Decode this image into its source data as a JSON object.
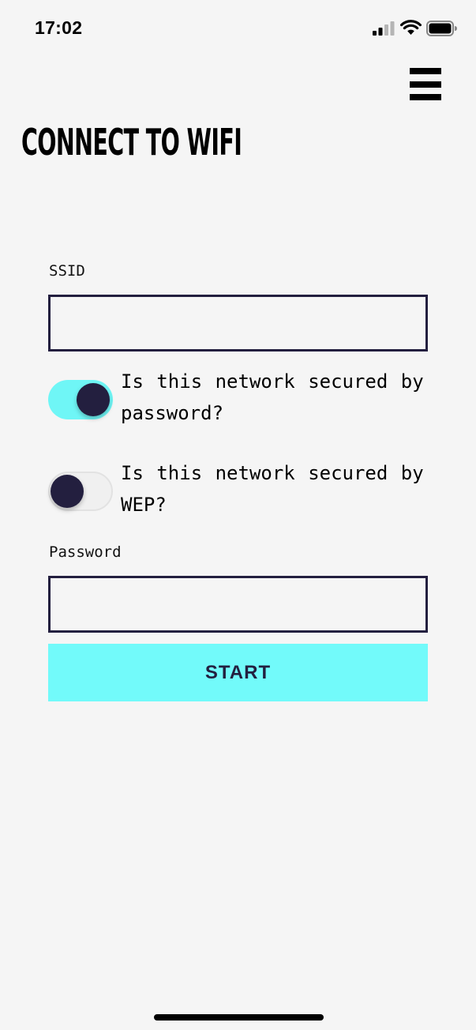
{
  "status_bar": {
    "time": "17:02",
    "icons": [
      "signal-icon",
      "wifi-icon",
      "battery-icon"
    ]
  },
  "header": {
    "menu_icon": "hamburger-menu-icon",
    "title": "CONNECT TO WIFI"
  },
  "form": {
    "ssid": {
      "label": "SSID",
      "value": "",
      "placeholder": ""
    },
    "toggles": [
      {
        "label": "Is this network secured by password?",
        "state": "on"
      },
      {
        "label": "Is this network secured by WEP?",
        "state": "off"
      }
    ],
    "password": {
      "label": "Password",
      "value": "",
      "placeholder": ""
    },
    "start_label": "START"
  },
  "colors": {
    "accent": "#72fafa",
    "navy": "#231f3f",
    "background": "#f5f5f5",
    "text": "#000000"
  }
}
